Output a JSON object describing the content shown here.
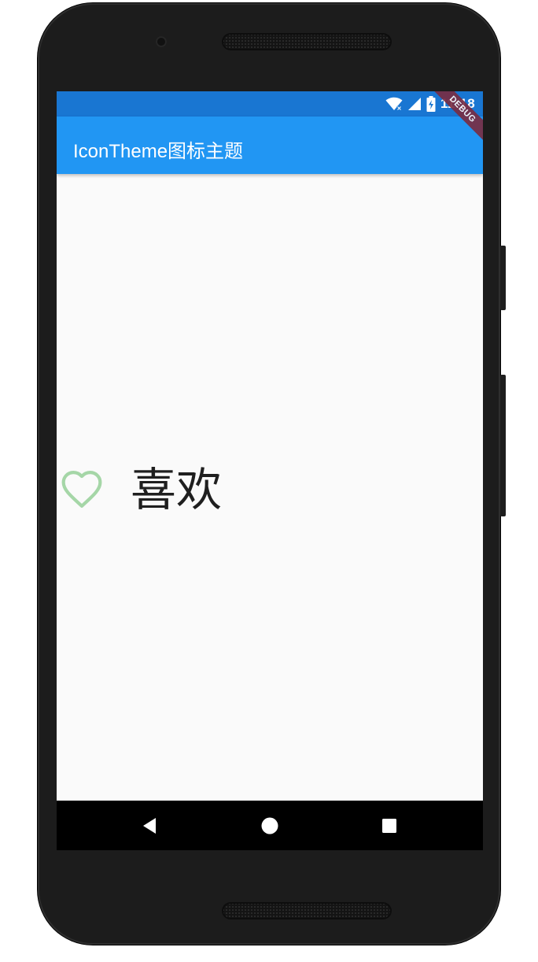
{
  "status_bar": {
    "time": "11:18",
    "icons": [
      "wifi-icon",
      "signal-icon",
      "battery-charging-icon"
    ]
  },
  "app_bar": {
    "title": "IconTheme图标主题",
    "color": "#2196f3",
    "status_color": "#1976d2"
  },
  "debug_banner": {
    "label": "DEBUG"
  },
  "content": {
    "icon": "heart-outline-icon",
    "icon_color": "#a5d6a7",
    "label": "喜欢"
  },
  "nav_bar": {
    "buttons": [
      "back-icon",
      "home-icon",
      "recents-icon"
    ]
  }
}
